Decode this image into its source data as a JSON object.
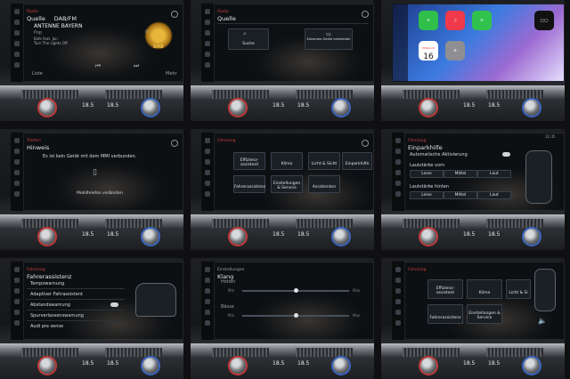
{
  "tiles": {
    "radio": {
      "section": "Radio",
      "tab_source": "Quelle",
      "band": "DAB/FM",
      "station": "ANTENNE BAYERN",
      "genre": "Pop",
      "song_line1": "Kafe feat. Jon",
      "song_line2": "Turn The Lights Off",
      "dab_logo": "DAB",
      "bottom_left": "Liste",
      "bottom_right": "Mehr"
    },
    "source": {
      "section": "Radio",
      "title": "Quelle",
      "option1": "Suche",
      "option2": "Externes Gerät verbinden"
    },
    "carplay": {
      "date_day": "16",
      "date_weekday": "Mittwoch",
      "apps": [
        "Telefon",
        "Musik",
        "Nachrichten",
        "Audi"
      ]
    },
    "notice": {
      "section": "Telefon",
      "title": "Hinweis",
      "message": "Es ist kein Gerät mit dem MMI verbunden.",
      "action": "Mobiltelefon verbinden"
    },
    "vehicle": {
      "section": "Fahrzeug",
      "items": [
        "Effizienz-assistent",
        "Klima",
        "Licht & Sicht",
        "Einparkhilfe",
        "Fahrerassistenz",
        "Einstellungen & Service",
        "Assistenten"
      ]
    },
    "parking": {
      "section": "Fahrzeug",
      "title": "Einparkhilfe",
      "clock": "12:35",
      "auto_activation": "Automatische Aktivierung",
      "front_volume": "Lautstärke vorn",
      "rear_volume": "Lautstärke hinten",
      "levels": [
        "Leise",
        "Mittel",
        "Laut"
      ]
    },
    "assist": {
      "section": "Fahrzeug",
      "title": "Fahrerassistenz",
      "items": [
        "Tempowarnung",
        "Adaptiver Fahrassistent",
        "Abstandswarnung",
        "Spurverlassenswarnung",
        "Audi pre sense"
      ]
    },
    "sound": {
      "section": "Einstellungen",
      "title": "Klang",
      "row1": "Höhen",
      "row2": "Bässe",
      "min": "Min",
      "max": "Max"
    },
    "vehicle2": {
      "section": "Fahrzeug",
      "items": [
        "Effizienz-assistent",
        "Klima",
        "Licht & Si",
        "Fahrerassistenz",
        "Einstellungen & Service"
      ]
    }
  },
  "climate": {
    "temp_left": "18.5",
    "temp_right": "18.5"
  }
}
